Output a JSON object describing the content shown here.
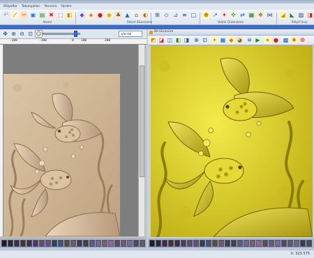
{
  "menu": [
    "Rölyefler",
    "Takımyolları",
    "Pencere",
    "Yardım"
  ],
  "ribbon_groups": {
    "group1": "Model",
    "group2": "Rölyef Düzenleme",
    "group3": "Vektör Düzenleme",
    "group4": "Rölyef Araç"
  },
  "left_pane": {
    "zoom_slider_level": 0.92,
    "view_selector": "ıyfor-btl",
    "ruler_labels": [
      "-200",
      "-100",
      "0",
      "100",
      "200"
    ]
  },
  "right_pane": {
    "title": "3B Görünüm"
  },
  "status": {
    "coords": "X: 323.575"
  },
  "palette_colors": [
    "#1c1c2a",
    "#2a2440",
    "#3d2b55",
    "#4a2e3a",
    "#3a3046",
    "#4d3a6a",
    "#5c4a7a",
    "#6b4a8a",
    "#2f3f6a",
    "#44508a",
    "#5a4a4a",
    "#6a5a70",
    "#3d3d5a",
    "#4a3a5a",
    "#5a5a8a",
    "#6a6a9a",
    "#7a5a8a",
    "#8a6a9a",
    "#5a4a6a",
    "#6a5a8a",
    "#7a6aa0",
    "#4a4a6a",
    "#5a5a7a"
  ],
  "palette_colors_right": [
    "#1c1c2a",
    "#2a2440",
    "#3d2b55",
    "#4a2e3a",
    "#3a3046",
    "#4d3a6a",
    "#5c4a7a",
    "#6b4a8a",
    "#2f3f6a",
    "#44508a",
    "#5a4a4a",
    "#6a5a70",
    "#3d3d5a",
    "#4a3a5a",
    "#5a5a8a",
    "#6a6a9a",
    "#7a5a8a",
    "#8a6a9a",
    "#5a4a6a",
    "#6a5a8a",
    "#7a6aa0",
    "#4a4a6a",
    "#5a5a7a",
    "#6a6a8a",
    "#3a3a5a",
    "#4a4a5a"
  ],
  "colors": {
    "relief_2d_base": "#cdb89a",
    "relief_3d_base": "#d8cc1e",
    "accent_blue": "#3e6cc2"
  },
  "icons": [
    "redo-icon",
    "cut-icon",
    "copy-icon",
    "paste-icon",
    "delete-icon",
    "select-icon",
    "measure-icon",
    "add-icon",
    "subtract-icon",
    "merge-icon",
    "smooth-icon",
    "sculpt-icon",
    "zoom-icon",
    "node-icon",
    "vector-icon",
    "text-icon",
    "shape-icon",
    "offset-icon",
    "trim-icon",
    "weld-icon",
    "align-icon",
    "mirror-icon",
    "grid-icon",
    "layers-icon"
  ]
}
